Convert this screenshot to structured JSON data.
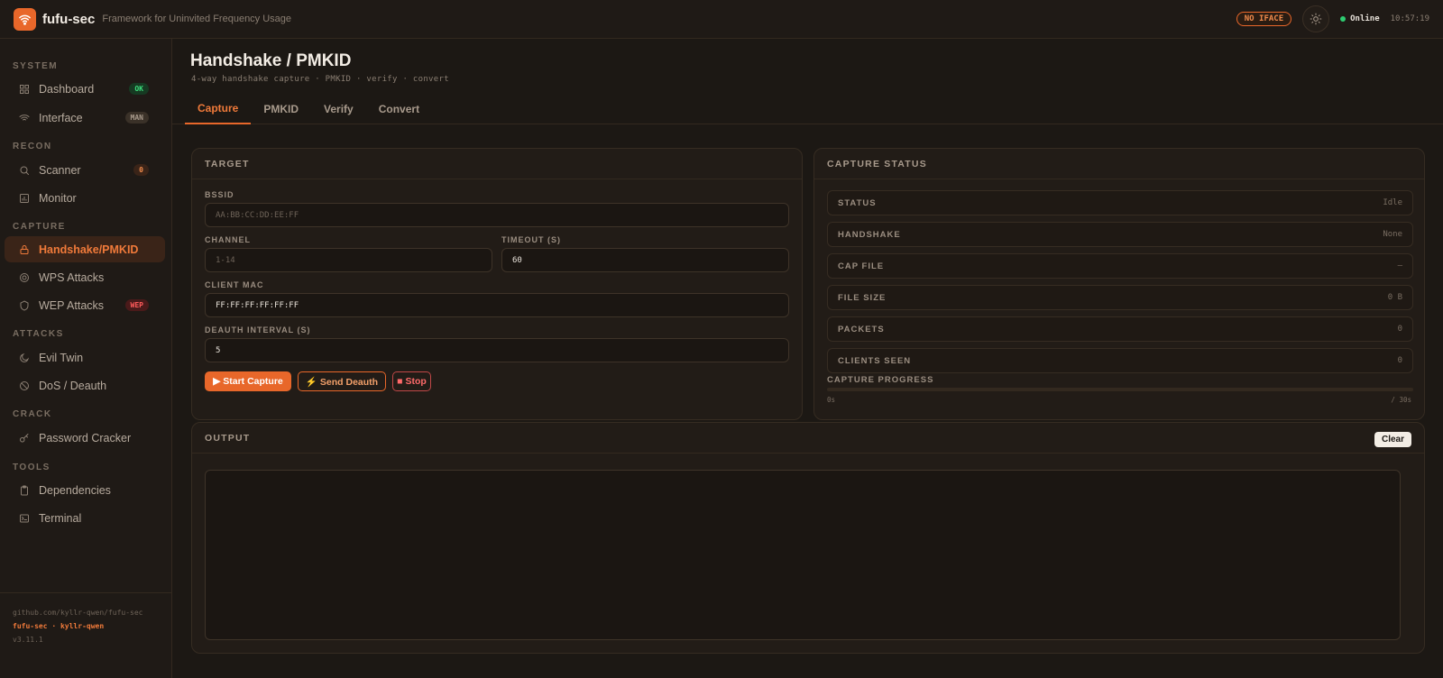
{
  "app": {
    "name": "fufu-sec",
    "tagline": "Framework for Uninvited Frequency Usage",
    "iface_badge": "NO IFACE",
    "status": "Online",
    "time": "10:57:19"
  },
  "sidebar": {
    "sections": [
      {
        "title": "SYSTEM",
        "items": [
          {
            "label": "Dashboard",
            "icon": "grid-icon",
            "badge": "OK"
          },
          {
            "label": "Interface",
            "icon": "wifi-icon",
            "badge": "MAN"
          }
        ]
      },
      {
        "title": "RECON",
        "items": [
          {
            "label": "Scanner",
            "icon": "search-icon",
            "badge": "0"
          },
          {
            "label": "Monitor",
            "icon": "bar-chart-icon"
          }
        ]
      },
      {
        "title": "CAPTURE",
        "items": [
          {
            "label": "Handshake/PMKID",
            "icon": "lock-icon",
            "active": true
          },
          {
            "label": "WPS Attacks",
            "icon": "target-icon"
          },
          {
            "label": "WEP Attacks",
            "icon": "shield-icon",
            "badge": "WEP"
          }
        ]
      },
      {
        "title": "ATTACKS",
        "items": [
          {
            "label": "Evil Twin",
            "icon": "moon-icon"
          },
          {
            "label": "DoS / Deauth",
            "icon": "ban-icon"
          }
        ]
      },
      {
        "title": "CRACK",
        "items": [
          {
            "label": "Password Cracker",
            "icon": "key-icon"
          }
        ]
      },
      {
        "title": "TOOLS",
        "items": [
          {
            "label": "Dependencies",
            "icon": "clipboard-icon"
          },
          {
            "label": "Terminal",
            "icon": "terminal-icon"
          }
        ]
      }
    ],
    "footer": {
      "repo": "github.com/kyllr-qwen/fufu-sec",
      "credits": "fufu-sec · kyllr-qwen",
      "version": "v3.11.1"
    }
  },
  "page": {
    "title": "Handshake / PMKID",
    "subtitle": "4-way handshake capture · PMKID · verify · convert",
    "tabs": [
      "Capture",
      "PMKID",
      "Verify",
      "Convert"
    ],
    "active_tab": "Capture"
  },
  "target": {
    "header": "TARGET",
    "bssid_label": "BSSID",
    "bssid_placeholder": "AA:BB:CC:DD:EE:FF",
    "channel_label": "CHANNEL",
    "channel_placeholder": "1-14",
    "timeout_label": "TIMEOUT (S)",
    "timeout_value": "60",
    "client_label": "CLIENT MAC",
    "client_value": "FF:FF:FF:FF:FF:FF",
    "deauth_label": "DEAUTH INTERVAL (S)",
    "deauth_value": "5",
    "start_label": "▶ Start Capture",
    "deauth_btn_label": "⚡ Send Deauth",
    "stop_label": "■ Stop"
  },
  "capture_status": {
    "header": "CAPTURE STATUS",
    "rows": [
      {
        "key": "STATUS",
        "value": "Idle"
      },
      {
        "key": "HANDSHAKE",
        "value": "None"
      },
      {
        "key": "CAP FILE",
        "value": "—"
      },
      {
        "key": "FILE SIZE",
        "value": "0 B"
      },
      {
        "key": "PACKETS",
        "value": "0"
      },
      {
        "key": "CLIENTS SEEN",
        "value": "0"
      }
    ],
    "progress_label": "CAPTURE PROGRESS",
    "progress_fraction": 0,
    "progress_min": "0s",
    "progress_max": "/ 30s"
  },
  "output": {
    "header": "OUTPUT",
    "clear_label": "Clear"
  },
  "colors": {
    "accent": "#e8672a",
    "background": "#1c1814",
    "online": "#2ecc71"
  }
}
